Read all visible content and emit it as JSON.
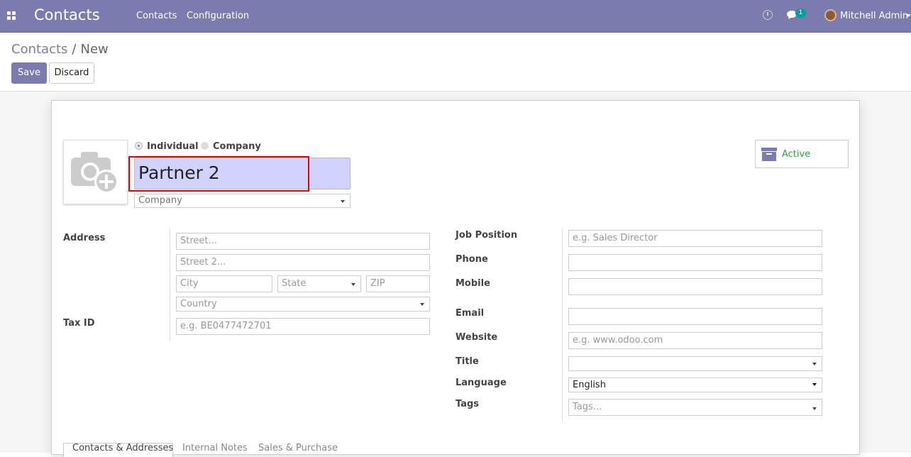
{
  "navbar": {
    "app_title": "Contacts",
    "menu": [
      "Contacts",
      "Configuration"
    ],
    "notification_count": "1",
    "user_name": "Mitchell Admin"
  },
  "control_panel": {
    "breadcrumb_parent": "Contacts",
    "breadcrumb_separator": "/",
    "breadcrumb_current": "New",
    "save_label": "Save",
    "discard_label": "Discard"
  },
  "form": {
    "type_options": [
      "Individual",
      "Company"
    ],
    "type_selected": "Individual",
    "name_value": "Partner 2",
    "company_placeholder": "Company",
    "active_label": "Active",
    "address_label": "Address",
    "street_placeholder": "Street...",
    "street2_placeholder": "Street 2...",
    "city_placeholder": "City",
    "state_placeholder": "State",
    "zip_placeholder": "ZIP",
    "country_placeholder": "Country",
    "tax_id_label": "Tax ID",
    "tax_id_placeholder": "e.g. BE0477472701",
    "job_position_label": "Job Position",
    "job_position_placeholder": "e.g. Sales Director",
    "phone_label": "Phone",
    "mobile_label": "Mobile",
    "email_label": "Email",
    "website_label": "Website",
    "website_placeholder": "e.g. www.odoo.com",
    "title_label": "Title",
    "language_label": "Language",
    "language_value": "English",
    "tags_label": "Tags",
    "tags_placeholder": "Tags..."
  },
  "tabs": [
    "Contacts & Addresses",
    "Internal Notes",
    "Sales & Purchase"
  ],
  "colors": {
    "navbar": "#7c7bad",
    "name_field_bg": "#d2d2ff",
    "highlight_box": "#e0000b",
    "active": "#28a745",
    "badge": "#00a09d"
  }
}
